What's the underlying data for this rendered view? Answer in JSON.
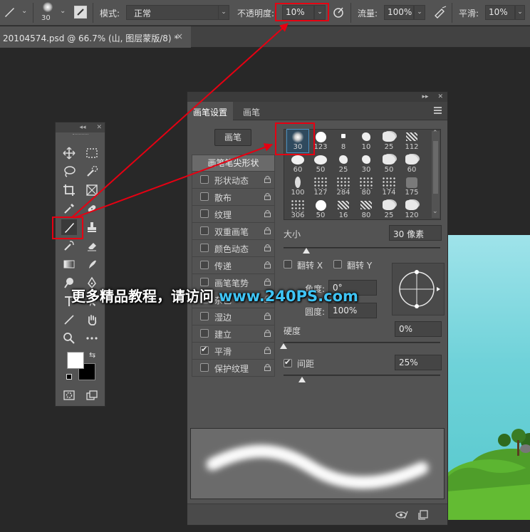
{
  "options_bar": {
    "brush_size": "30",
    "mode_label": "模式:",
    "mode_value": "正常",
    "opacity_label": "不透明度:",
    "opacity_value": "10%",
    "flow_label": "流量:",
    "flow_value": "100%",
    "smoothing_label": "平滑:",
    "smoothing_value": "10%"
  },
  "document_tab": {
    "title": "20104574.psd @ 66.7% (山, 图层蒙版/8) *",
    "close": "×"
  },
  "toolbox": {
    "collapse": "◂◂",
    "close": "✕"
  },
  "panel": {
    "collapse": "▸▸",
    "close": "✕",
    "tabs": [
      {
        "label": "画笔设置"
      },
      {
        "label": "画笔"
      }
    ],
    "brush_button": "画笔",
    "options": [
      {
        "label": "画笔笔尖形状"
      },
      {
        "label": "形状动态",
        "checked": false
      },
      {
        "label": "散布",
        "checked": false
      },
      {
        "label": "纹理",
        "checked": false
      },
      {
        "label": "双重画笔",
        "checked": false
      },
      {
        "label": "颜色动态",
        "checked": false
      },
      {
        "label": "传递",
        "checked": false
      },
      {
        "label": "画笔笔势",
        "checked": false
      },
      {
        "label": "杂色",
        "checked": false
      },
      {
        "label": "湿边",
        "checked": false
      },
      {
        "label": "建立",
        "checked": false
      },
      {
        "label": "平滑",
        "checked": true
      },
      {
        "label": "保护纹理",
        "checked": false
      }
    ],
    "brush_sizes": [
      "30",
      "123",
      "8",
      "10",
      "25",
      "112",
      "60",
      "50",
      "25",
      "30",
      "50",
      "60",
      "100",
      "127",
      "284",
      "80",
      "174",
      "175",
      "306",
      "50",
      "16",
      "80",
      "25",
      "120"
    ],
    "size_label": "大小",
    "size_value": "30 像素",
    "size_fraction": 0.06,
    "flip_x_label": "翻转 X",
    "flip_y_label": "翻转 Y",
    "angle_label": "角度:",
    "angle_value": "0°",
    "roundness_label": "圆度:",
    "roundness_value": "100%",
    "hardness_label": "硬度",
    "hardness_value": "0%",
    "spacing_label": "间距",
    "spacing_value": "25%",
    "spacing_checked": true
  },
  "watermark": {
    "text": "更多精品教程，请访问",
    "site": "www.240PS.com"
  },
  "colors": {
    "annotation_red": "#e60012",
    "watermark_blue": "#3fc4f5",
    "panel_bg": "#535353"
  }
}
